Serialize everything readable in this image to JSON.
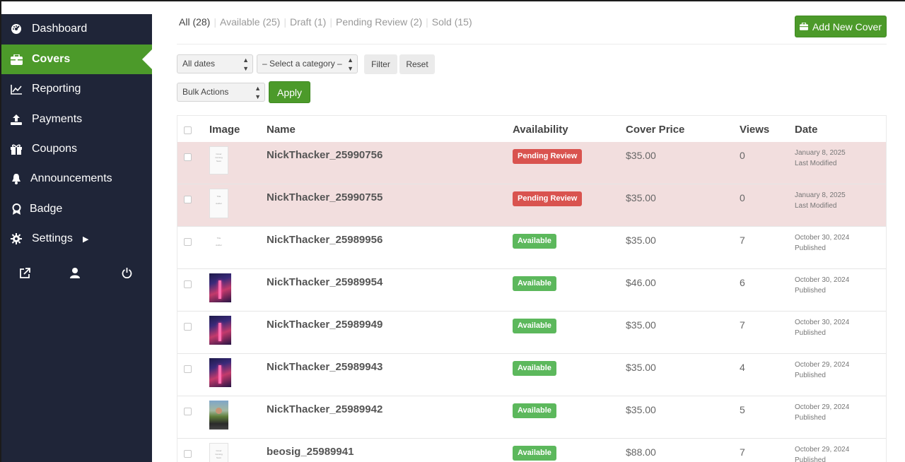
{
  "sidebar": {
    "items": [
      {
        "label": "Dashboard",
        "icon": "dashboard-icon"
      },
      {
        "label": "Covers",
        "icon": "briefcase-icon",
        "active": true
      },
      {
        "label": "Reporting",
        "icon": "line-chart-icon"
      },
      {
        "label": "Payments",
        "icon": "upload-icon"
      },
      {
        "label": "Coupons",
        "icon": "gift-icon"
      },
      {
        "label": "Announcements",
        "icon": "bell-icon"
      },
      {
        "label": "Badge",
        "icon": "badge-icon"
      },
      {
        "label": "Settings",
        "icon": "gear-icon"
      }
    ],
    "bottom_icons": [
      "external-link-icon",
      "user-icon",
      "power-icon"
    ]
  },
  "tabs": [
    {
      "label": "All (28)",
      "current": true
    },
    {
      "label": "Available (25)"
    },
    {
      "label": "Draft (1)"
    },
    {
      "label": "Pending Review (2)"
    },
    {
      "label": "Sold (15)"
    }
  ],
  "toolbar": {
    "add_label": "Add New Cover",
    "dates_select": "All dates",
    "category_select": "– Select a category –",
    "filter_label": "Filter",
    "reset_label": "Reset",
    "bulk_select": "Bulk Actions",
    "apply_label": "Apply"
  },
  "table": {
    "headers": {
      "image": "Image",
      "name": "Name",
      "availability": "Availability",
      "price": "Cover Price",
      "views": "Views",
      "date": "Date"
    },
    "rows": [
      {
        "name": "NickThacker_25990756",
        "status": "Pending Review",
        "price": "$35.00",
        "views": "0",
        "date": "January 8, 2025",
        "date_note": "Last Modified"
      },
      {
        "name": "NickThacker_25990755",
        "status": "Pending Review",
        "price": "$35.00",
        "views": "0",
        "date": "January 8, 2025",
        "date_note": "Last Modified"
      },
      {
        "name": "NickThacker_25989956",
        "status": "Available",
        "price": "$35.00",
        "views": "7",
        "date": "October 30, 2024",
        "date_note": "Published"
      },
      {
        "name": "NickThacker_25989954",
        "status": "Available",
        "price": "$46.00",
        "views": "6",
        "date": "October 30, 2024",
        "date_note": "Published"
      },
      {
        "name": "NickThacker_25989949",
        "status": "Available",
        "price": "$35.00",
        "views": "7",
        "date": "October 30, 2024",
        "date_note": "Published"
      },
      {
        "name": "NickThacker_25989943",
        "status": "Available",
        "price": "$35.00",
        "views": "4",
        "date": "October 29, 2024",
        "date_note": "Published"
      },
      {
        "name": "NickThacker_25989942",
        "status": "Available",
        "price": "$35.00",
        "views": "5",
        "date": "October 29, 2024",
        "date_note": "Published"
      },
      {
        "name": "beosig_25989941",
        "status": "Available",
        "price": "$88.00",
        "views": "7",
        "date": "October 29, 2024",
        "date_note": "Published"
      }
    ]
  },
  "colors": {
    "sidebar_bg": "#1f2538",
    "accent": "#4c9a2a",
    "pending": "#d9534f",
    "available": "#5cb85c",
    "pending_row": "#f2dede"
  }
}
